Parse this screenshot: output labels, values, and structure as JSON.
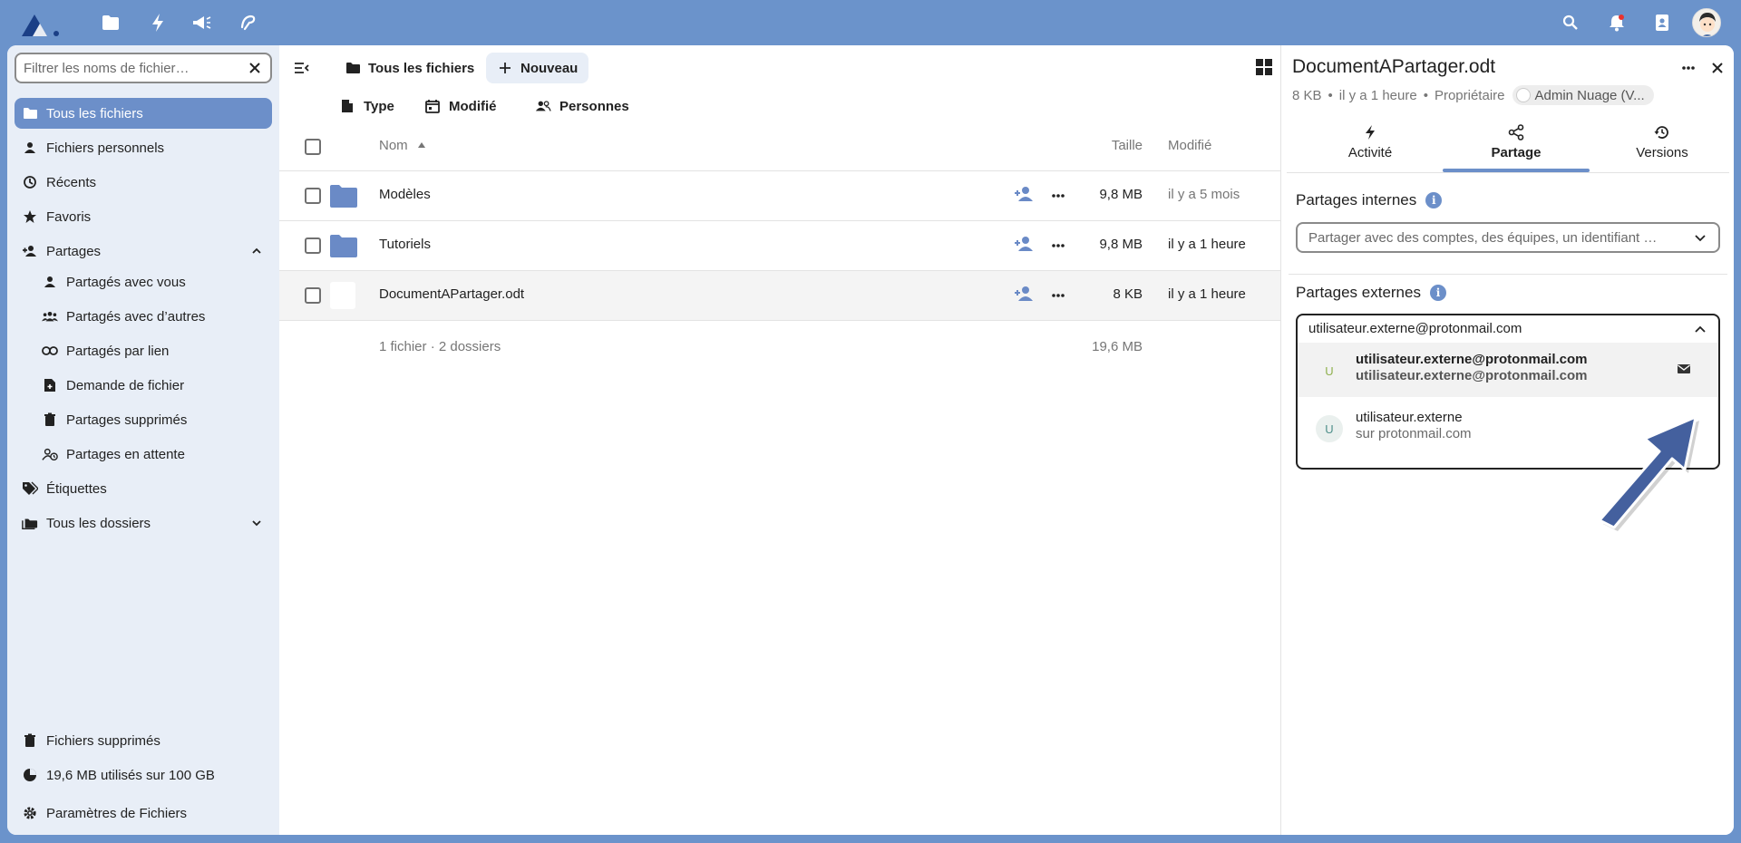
{
  "colors": {
    "accent": "#6c8fc9",
    "header_bg": "#6b93cb",
    "folder": "#6a8ac6",
    "annotation_arrow": "#44609e"
  },
  "header": {
    "apps": [
      "files-icon",
      "activity-icon",
      "announcements-icon",
      "notes-icon"
    ],
    "right": [
      "search-icon",
      "notifications-icon",
      "contacts-icon",
      "user-avatar"
    ]
  },
  "sidebar": {
    "filter_placeholder": "Filtrer les noms de fichier…",
    "items": [
      {
        "label": "Tous les fichiers",
        "icon": "folder-icon"
      },
      {
        "label": "Fichiers personnels",
        "icon": "person-icon"
      },
      {
        "label": "Récents",
        "icon": "history-icon"
      },
      {
        "label": "Favoris",
        "icon": "star-icon"
      },
      {
        "label": "Partages",
        "icon": "share-icon"
      },
      {
        "label": "Partagés avec vous",
        "icon": "person-icon"
      },
      {
        "label": "Partagés avec d’autres",
        "icon": "group-icon"
      },
      {
        "label": "Partagés par lien",
        "icon": "link-icon"
      },
      {
        "label": "Demande de fichier",
        "icon": "file-request-icon"
      },
      {
        "label": "Partages supprimés",
        "icon": "trash-icon"
      },
      {
        "label": "Partages en attente",
        "icon": "pending-icon"
      },
      {
        "label": "Étiquettes",
        "icon": "tag-icon"
      },
      {
        "label": "Tous les dossiers",
        "icon": "folders-icon"
      }
    ],
    "bottom": {
      "trash": "Fichiers supprimés",
      "quota": "19,6 MB utilisés sur 100 GB",
      "settings": "Paramètres de Fichiers"
    }
  },
  "main": {
    "breadcrumb": "Tous les fichiers",
    "new_label": "Nouveau",
    "filters": [
      "Type",
      "Modifié",
      "Personnes"
    ],
    "columns": {
      "name": "Nom",
      "size": "Taille",
      "modified": "Modifié"
    },
    "rows": [
      {
        "name": "Modèles",
        "type": "folder",
        "size": "9,8 MB",
        "modified": "il y a 5 mois"
      },
      {
        "name": "Tutoriels",
        "type": "folder",
        "size": "9,8 MB",
        "modified": "il y a 1 heure"
      },
      {
        "name": "DocumentAPartager.odt",
        "type": "file",
        "size": "8 KB",
        "modified": "il y a 1 heure"
      }
    ],
    "summary": {
      "counts": "1 fichier · 2 dossiers",
      "total": "19,6 MB"
    }
  },
  "details": {
    "title": "DocumentAPartager.odt",
    "size": "8 KB",
    "time": "il y a 1 heure",
    "owner_label": "Propriétaire",
    "owner_name": "Admin Nuage (V...",
    "tabs": [
      "Activité",
      "Partage",
      "Versions"
    ],
    "internal_heading": "Partages internes",
    "internal_placeholder": "Partager avec des comptes, des équipes, un identifiant …",
    "external_heading": "Partages externes",
    "external_query": "utilisateur.externe@protonmail.com",
    "options": [
      {
        "avatar": "U",
        "line1": "utilisateur.externe@protonmail.com",
        "line2": "utilisateur.externe@protonmail.com"
      },
      {
        "avatar": "U",
        "line1": "utilisateur.externe",
        "line2": "sur protonmail.com"
      }
    ]
  }
}
